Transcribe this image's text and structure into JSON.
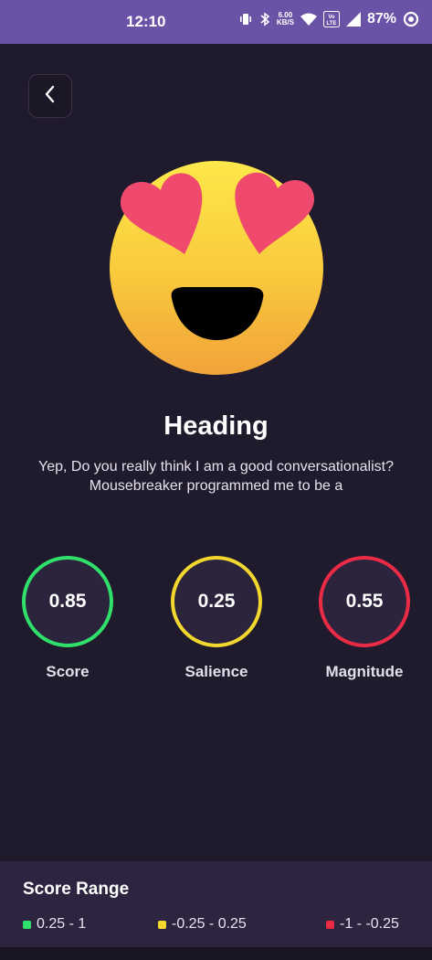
{
  "status_bar": {
    "time": "12:10",
    "net_speed_value": "6.00",
    "net_speed_unit": "KB/S",
    "battery": "87%",
    "volte_label": "VoLTE",
    "icons": [
      "vibrate-icon",
      "bluetooth-icon",
      "wifi-icon",
      "volte-icon",
      "signal-icon",
      "battery-ring-icon"
    ]
  },
  "back_button": {
    "icon": "chevron-left-icon"
  },
  "emoji": {
    "icon": "heart-eyes-emoji-icon"
  },
  "heading": "Heading",
  "description": "Yep, Do you really think I am a good conversationalist? Mousebreaker programmed me to be a",
  "metrics": [
    {
      "value": "0.85",
      "label": "Score",
      "color": "#2fe06a"
    },
    {
      "value": "0.25",
      "label": "Salience",
      "color": "#f2d72e"
    },
    {
      "value": "0.55",
      "label": "Magnitude",
      "color": "#ea2b46"
    }
  ],
  "score_range": {
    "title": "Score Range",
    "items": [
      {
        "label": "0.25 - 1",
        "color": "#2fe06a"
      },
      {
        "label": "-0.25 - 0.25",
        "color": "#f2d72e"
      },
      {
        "label": "-1 - -0.25",
        "color": "#ea2b46"
      }
    ]
  }
}
